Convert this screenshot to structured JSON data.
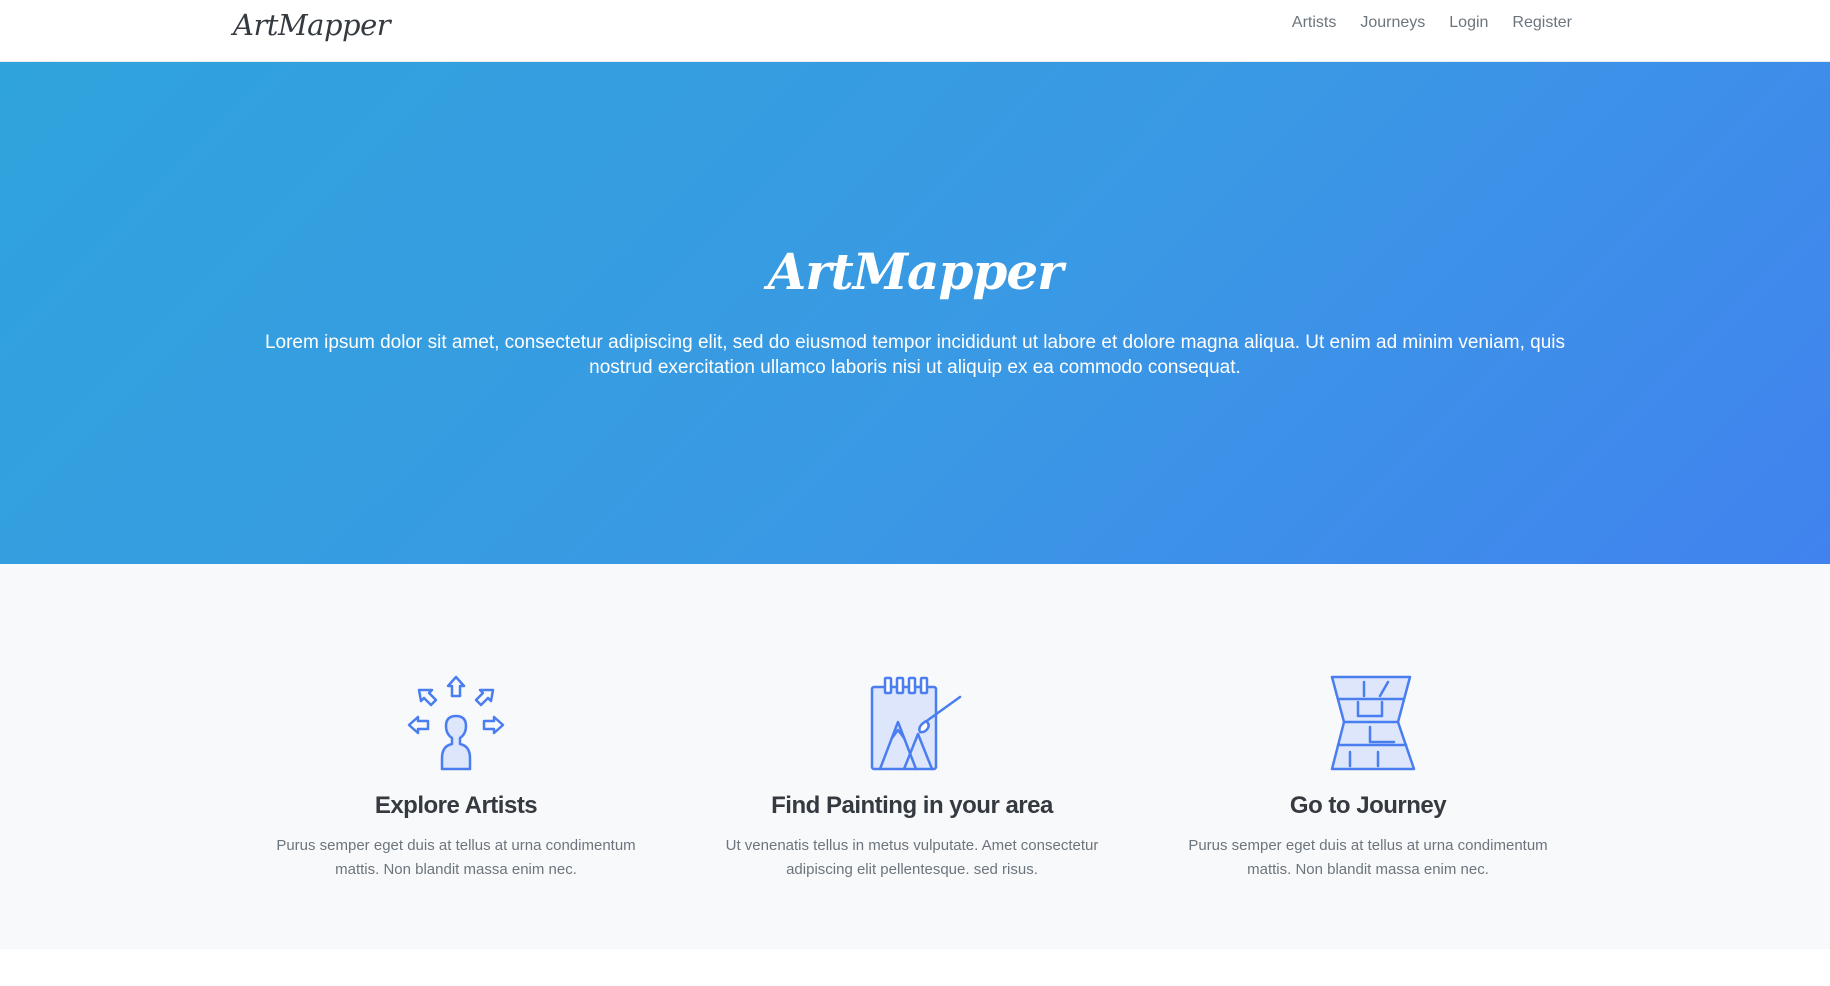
{
  "navbar": {
    "brand": "ArtMapper",
    "links": [
      "Artists",
      "Journeys",
      "Login",
      "Register"
    ]
  },
  "hero": {
    "title": "ArtMapper",
    "text": "Lorem ipsum dolor sit amet, consectetur adipiscing elit, sed do eiusmod tempor incididunt ut labore et dolore magna aliqua. Ut enim ad minim veniam, quis nostrud exercitation ullamco laboris nisi ut aliquip ex ea commodo consequat."
  },
  "features": [
    {
      "icon": "person-arrows-icon",
      "title": "Explore Artists",
      "desc": "Purus semper eget duis at tellus at urna condimentum mattis. Non blandit massa enim nec."
    },
    {
      "icon": "sketchbook-painting-icon",
      "title": "Find Painting in your area",
      "desc": "Ut venenatis tellus in metus vulputate. Amet consectetur adipiscing elit pellentesque. sed risus."
    },
    {
      "icon": "folded-map-icon",
      "title": "Go to Journey",
      "desc": "Purus semper eget duis at tellus at urna condimentum mattis. Non blandit massa enim nec."
    }
  ],
  "colors": {
    "accent": "#4a7ef0",
    "hero_start": "#2fa3dc",
    "hero_end": "#4182ef",
    "feature_bg": "#f8f9fa"
  }
}
